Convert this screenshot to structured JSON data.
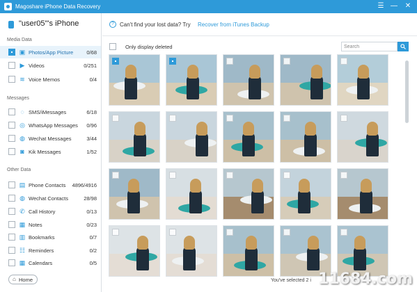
{
  "titlebar": {
    "title": "Magoshare iPhone Data Recovery",
    "minimize_glyph": "☰",
    "restore_glyph": "—",
    "close_glyph": "✕"
  },
  "device": {
    "name": "\"user05\"'s iPhone",
    "icon": "iphone-icon"
  },
  "sidebar": {
    "sections": [
      {
        "label": "Media Data",
        "items": [
          {
            "label": "Photos/App Picture",
            "count": "0/68",
            "icon": "photo-icon",
            "glyph": "▣",
            "active": true,
            "checked": true
          },
          {
            "label": "Videos",
            "count": "0/251",
            "icon": "video-icon",
            "glyph": "▶",
            "active": false,
            "checked": false
          },
          {
            "label": "Voice Memos",
            "count": "0/4",
            "icon": "audio-icon",
            "glyph": "≋",
            "active": false,
            "checked": false
          }
        ]
      },
      {
        "label": "Messages",
        "items": [
          {
            "label": "SMS/iMessages",
            "count": "6/18",
            "icon": "message-icon",
            "glyph": "◌",
            "active": false,
            "checked": false
          },
          {
            "label": "WhatsApp Messages",
            "count": "0/96",
            "icon": "whatsapp-icon",
            "glyph": "◎",
            "active": false,
            "checked": false
          },
          {
            "label": "Wechat Messages",
            "count": "3/44",
            "icon": "wechat-icon",
            "glyph": "◍",
            "active": false,
            "checked": false
          },
          {
            "label": "Kik Messages",
            "count": "1/52",
            "icon": "kik-icon",
            "glyph": "◙",
            "active": false,
            "checked": false
          }
        ]
      },
      {
        "label": "Other Data",
        "items": [
          {
            "label": "Phone Contacts",
            "count": "4896/4916",
            "icon": "contacts-icon",
            "glyph": "▤",
            "active": false,
            "checked": false
          },
          {
            "label": "Wechat Contacts",
            "count": "28/98",
            "icon": "wechat-contacts-icon",
            "glyph": "◍",
            "active": false,
            "checked": false
          },
          {
            "label": "Call History",
            "count": "0/13",
            "icon": "phone-icon",
            "glyph": "✆",
            "active": false,
            "checked": false
          },
          {
            "label": "Notes",
            "count": "0/23",
            "icon": "notes-icon",
            "glyph": "▦",
            "active": false,
            "checked": false
          },
          {
            "label": "Bookmarks",
            "count": "0/7",
            "icon": "bookmark-icon",
            "glyph": "▥",
            "active": false,
            "checked": false
          },
          {
            "label": "Reminders",
            "count": "0/2",
            "icon": "reminder-icon",
            "glyph": "☷",
            "active": false,
            "checked": false
          },
          {
            "label": "Calendars",
            "count": "0/5",
            "icon": "calendar-icon",
            "glyph": "▦",
            "active": false,
            "checked": false
          }
        ]
      }
    ],
    "home_label": "Home"
  },
  "banner": {
    "text": "Can't find your lost data? Try",
    "link": "Recover from iTunes Backup"
  },
  "filter": {
    "label": "Only display deleted"
  },
  "search": {
    "placeholder": "Search",
    "value": ""
  },
  "status": {
    "text": "You've selected 2 i"
  },
  "watermark": {
    "text": "11684.com"
  },
  "colors": {
    "accent": "#2e9ad9",
    "sidebar_active": "#e8f3fb",
    "teal": "#2fa7a4",
    "hair": "#c79c5b",
    "wetsuit": "#1f2d3a"
  },
  "photos": [
    {
      "selected": true,
      "scene": "beach-surfboard"
    },
    {
      "selected": true,
      "scene": "beach-surfboard"
    },
    {
      "selected": false,
      "scene": "beach-walk"
    },
    {
      "selected": false,
      "scene": "beach-walk"
    },
    {
      "selected": false,
      "scene": "beach-wave"
    },
    {
      "selected": false,
      "scene": "surfboard-smile"
    },
    {
      "selected": false,
      "scene": "surfboard-smile"
    },
    {
      "selected": false,
      "scene": "beach-sit"
    },
    {
      "selected": false,
      "scene": "beach-sit"
    },
    {
      "selected": false,
      "scene": "surfboard-raised"
    },
    {
      "selected": false,
      "scene": "beach-walk"
    },
    {
      "selected": false,
      "scene": "two-friends"
    },
    {
      "selected": false,
      "scene": "pier-friends"
    },
    {
      "selected": false,
      "scene": "beach-jump"
    },
    {
      "selected": false,
      "scene": "pier-friends"
    },
    {
      "selected": false,
      "scene": "portrait"
    },
    {
      "selected": false,
      "scene": "portrait"
    },
    {
      "selected": false,
      "scene": "beach-sit"
    },
    {
      "selected": false,
      "scene": "beach-friends"
    },
    {
      "selected": false,
      "scene": "beach-friends"
    }
  ]
}
